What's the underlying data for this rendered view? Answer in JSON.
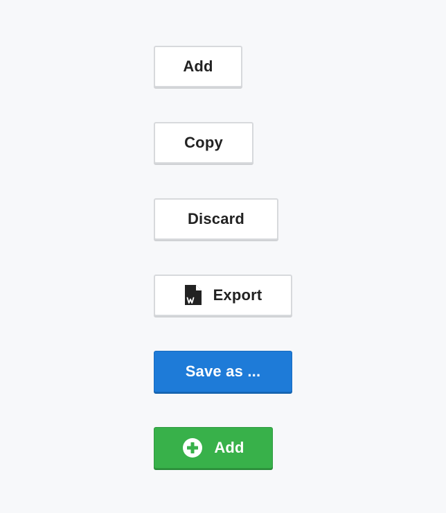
{
  "buttons": {
    "add": {
      "label": "Add"
    },
    "copy": {
      "label": "Copy"
    },
    "discard": {
      "label": "Discard"
    },
    "export": {
      "label": "Export",
      "icon": "word-document-icon"
    },
    "save_as": {
      "label": "Save as ..."
    },
    "add_primary": {
      "label": "Add",
      "icon": "plus-circle-icon"
    }
  },
  "colors": {
    "background": "#f7f8fa",
    "primary": "#1e7bd8",
    "success": "#38b14a",
    "default_border": "#d7d9dc",
    "text_dark": "#222222"
  }
}
